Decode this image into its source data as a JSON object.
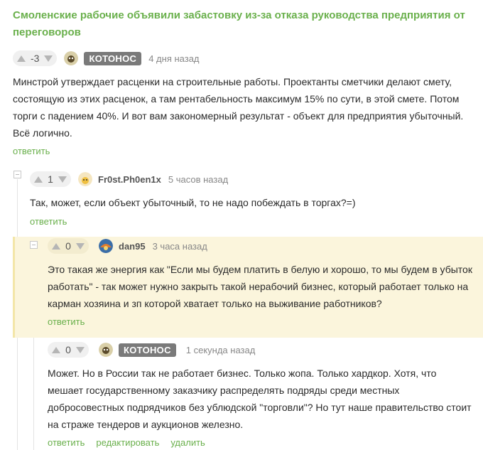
{
  "post": {
    "title": "Смоленские рабочие объявили забастовку из-за отказа руководства предприятия от переговоров"
  },
  "colors": {
    "accent": "#6ab04c",
    "highlight": "#fbf5dc",
    "badge": "#7a7a7a"
  },
  "comments": [
    {
      "score": "-3",
      "author": "КОТОНОС",
      "time": "4 дня назад",
      "text": "Минстрой утверждает расценки на строительные работы. Проектанты сметчики делают смету, состоящую из этих расценок, а там рентабельность максимум 15% по сути, в этой смете. Потом торги с падением 40%. И вот вам закономерный результат - объект для предприятия убыточный. Всё логично.",
      "reply": "ответить"
    },
    {
      "score": "1",
      "author": "Fr0st.Ph0en1x",
      "time": "5 часов назад",
      "text": "Так, может, если объект убыточный, то не надо побеждать в торгах?=)",
      "reply": "ответить"
    },
    {
      "score": "0",
      "author": "dan95",
      "time": "3 часа назад",
      "text": "Это такая же энергия как \"Если мы будем платить в белую и хорошо, то мы будем в убыток работать\" - так может нужно закрыть такой нерабочий бизнес, который работает только на карман хозяина и зп которой хватает только на выживание работников?",
      "reply": "ответить"
    },
    {
      "score": "0",
      "author": "КОТОНОС",
      "time": "1 секунда назад",
      "text": "Может. Но в России так не работает бизнес. Только жопа. Только хардкор. Хотя, что мешает государственному заказчику распределять подряды среди местных добросовестных подрядчиков без ублюдской \"торговли\"? Но тут наше правительство стоит на страже тендеров и аукционов железно.",
      "reply": "ответить",
      "edit": "редактировать",
      "delete": "удалить"
    }
  ]
}
